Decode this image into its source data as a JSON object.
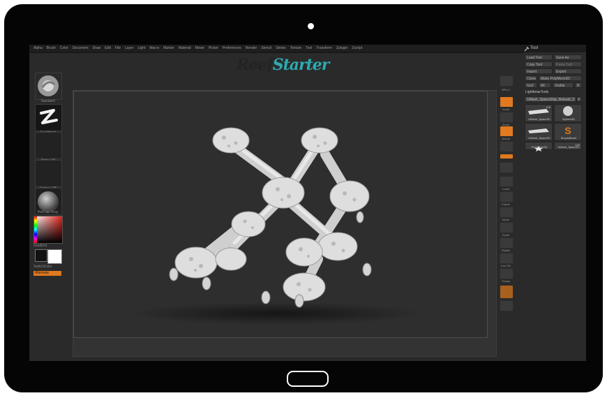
{
  "app": {
    "menu": [
      "Alpha",
      "Brush",
      "Color",
      "Document",
      "Draw",
      "Edit",
      "File",
      "Layer",
      "Light",
      "Macro",
      "Marker",
      "Material",
      "Movie",
      "Picker",
      "Preferences",
      "Render",
      "Stencil",
      "Stroke",
      "Texture",
      "Tool",
      "Transform",
      "Zplugin",
      "Zscript"
    ],
    "logo": {
      "part1": "Reef",
      "part2": "Starter"
    }
  },
  "left_shelf": {
    "brush": "Standard",
    "stroke": "FreeHand",
    "alpha": "Alpha Off",
    "texture": "Texture Off",
    "material": "MatCap Gray",
    "gradient": "Gradient",
    "switch_color": "SwitchColor",
    "alternate": "Alternate"
  },
  "right_shelf": {
    "spix": "SPix 3",
    "buttons": [
      "Scroll",
      "Zoom",
      "Actual",
      "AAHalf",
      "Persp",
      "Floor",
      "Local",
      "Frame",
      "Move",
      "Scale",
      "Rotate",
      "Line Fill PolyF",
      "Transp",
      "Ghost",
      "Solo",
      "Xpose"
    ]
  },
  "tool_panel": {
    "title": "Tool",
    "buttons": {
      "load": "Load Tool",
      "save_as": "Save As",
      "copy": "Copy Tool",
      "paste": "Paste Tool",
      "import": "Import",
      "export": "Export",
      "clone": "Clone",
      "make_polymesh": "Make PolyMesh3D",
      "goz": "GoZ",
      "all": "All",
      "visible": "Visible",
      "r": "R"
    },
    "lightbox_tools": "Lightbox▸Tools",
    "current_tool": "UMesh_SpaceShip_Rebuild_5",
    "current_count": "4",
    "subtools": [
      {
        "label": "UMesh_SpaceSh",
        "count": "125"
      },
      {
        "label": "Sphere3D",
        "count": ""
      },
      {
        "label": "UMesh_SpaceSh",
        "count": ""
      },
      {
        "label": "SimpleBrush",
        "count": ""
      },
      {
        "label": "PolyMesh3D",
        "count": ""
      },
      {
        "label": "UMesh_SpaceSh",
        "count": "125"
      }
    ]
  },
  "colors": {
    "accent": "#e0791f",
    "logo_teal": "#2eaab1",
    "logo_dark": "#232323"
  }
}
